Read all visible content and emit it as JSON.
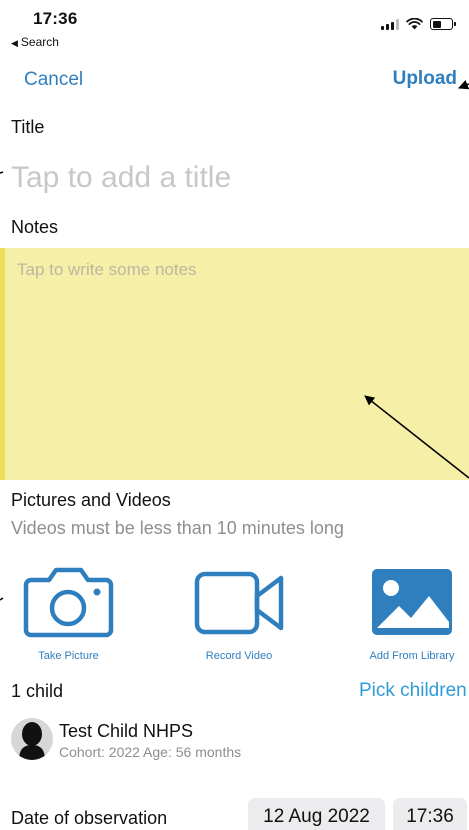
{
  "status_bar": {
    "time": "17:36",
    "back_label": "Search"
  },
  "nav": {
    "cancel_label": "Cancel",
    "upload_label": "Upload"
  },
  "title_section": {
    "label": "Title",
    "placeholder": "Tap to add a title"
  },
  "notes_section": {
    "label": "Notes",
    "placeholder": "Tap to write some notes",
    "background_color": "#f5efa8"
  },
  "media": {
    "heading": "Pictures and Videos",
    "subtext": "Videos must be less than 10 minutes long",
    "buttons": [
      {
        "label": "Take Picture",
        "icon": "camera-icon"
      },
      {
        "label": "Record Video",
        "icon": "video-camera-icon"
      },
      {
        "label": "Add From Library",
        "icon": "photo-library-icon"
      }
    ]
  },
  "children": {
    "count_label": "1 child",
    "pick_label": "Pick children",
    "list": [
      {
        "name": "Test Child NHPS",
        "meta": "Cohort: 2022 Age: 56 months"
      }
    ]
  },
  "observation": {
    "label": "Date of observation",
    "date": "12 Aug 2022",
    "time": "17:36"
  },
  "colors": {
    "accent": "#2f7fbf",
    "link": "#2f9bd8"
  }
}
